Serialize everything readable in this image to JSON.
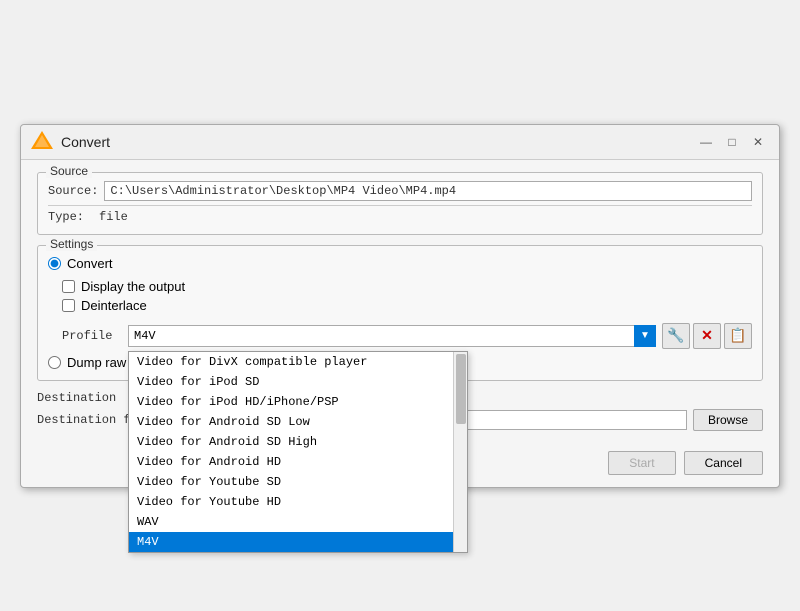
{
  "window": {
    "title": "Convert",
    "icon": "vlc-icon",
    "controls": {
      "minimize": "—",
      "maximize": "□",
      "close": "✕"
    }
  },
  "source": {
    "section_label": "Source",
    "source_label": "Source:",
    "source_value": "C:\\Users\\Administrator\\Desktop\\MP4 Video\\MP4.mp4",
    "type_label": "Type:",
    "type_value": "file"
  },
  "settings": {
    "section_label": "Settings",
    "convert_label": "Convert",
    "display_output_label": "Display the output",
    "deinterlace_label": "Deinterlace",
    "profile_label": "Profile",
    "profile_value": "M4V",
    "dropdown_items": [
      "Video for DivX compatible player",
      "Video for iPod SD",
      "Video for iPod HD/iPhone/PSP",
      "Video for Android SD Low",
      "Video for Android SD High",
      "Video for Android HD",
      "Video for Youtube SD",
      "Video for Youtube HD",
      "WAV",
      "M4V"
    ],
    "selected_index": 9,
    "wrench_icon": "🔧",
    "delete_icon": "✕",
    "list_icon": "📋",
    "dump_label": "Dump raw input"
  },
  "destination": {
    "section_label": "Destination",
    "dest_file_label": "Destination file:",
    "dest_value": "",
    "browse_label": "Browse"
  },
  "footer": {
    "start_label": "Start",
    "cancel_label": "Cancel"
  }
}
